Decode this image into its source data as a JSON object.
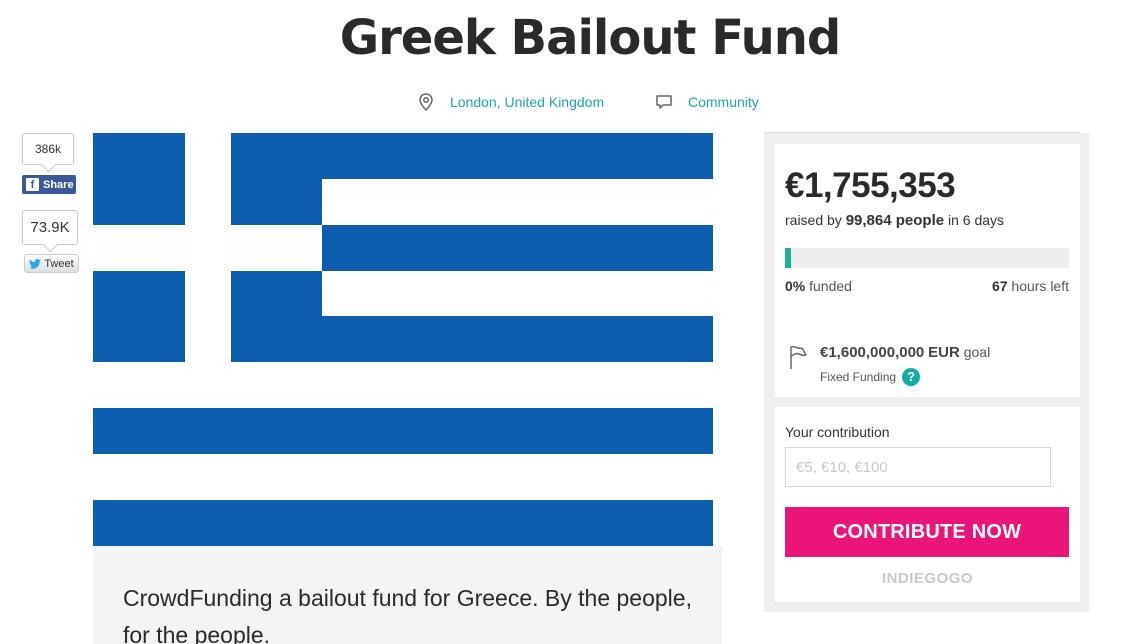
{
  "campaign": {
    "title": "Greek Bailout Fund",
    "location": "London, United Kingdom",
    "category": "Community",
    "description": "CrowdFunding a bailout fund for Greece. By the people, for the people."
  },
  "social": {
    "facebook_count": "386k",
    "facebook_label": "Share",
    "twitter_count": "73.9K",
    "twitter_label": "Tweet",
    "facebook_color": "#3b5998"
  },
  "funding": {
    "amount": "€1,755,353",
    "raised_prefix": "raised by",
    "people": "99,864 people",
    "raised_suffix": "in 6 days",
    "progress_fraction": 0.02,
    "percent": "0%",
    "funded_label": "funded",
    "hours": "67",
    "hours_label": "hours left",
    "goal_amount": "€1,600,000,000",
    "goal_currency": "EUR",
    "goal_label": "goal",
    "funding_type": "Fixed Funding",
    "help_glyph": "?"
  },
  "contribution": {
    "label": "Your contribution",
    "placeholder": "€5, €10, €100",
    "button": "CONTRIBUTE NOW",
    "brand": "INDIEGOGO"
  },
  "colors": {
    "accent_teal": "#1fa7a0",
    "progress": "#1ab394",
    "cta": "#eb1478",
    "flag_blue": "#0d5eaf"
  },
  "icons": {
    "location": "location-pin-icon",
    "category": "speech-bubble-icon",
    "goal": "flag-icon",
    "help": "question-mark-icon",
    "facebook": "facebook-icon",
    "twitter": "twitter-bird-icon"
  }
}
